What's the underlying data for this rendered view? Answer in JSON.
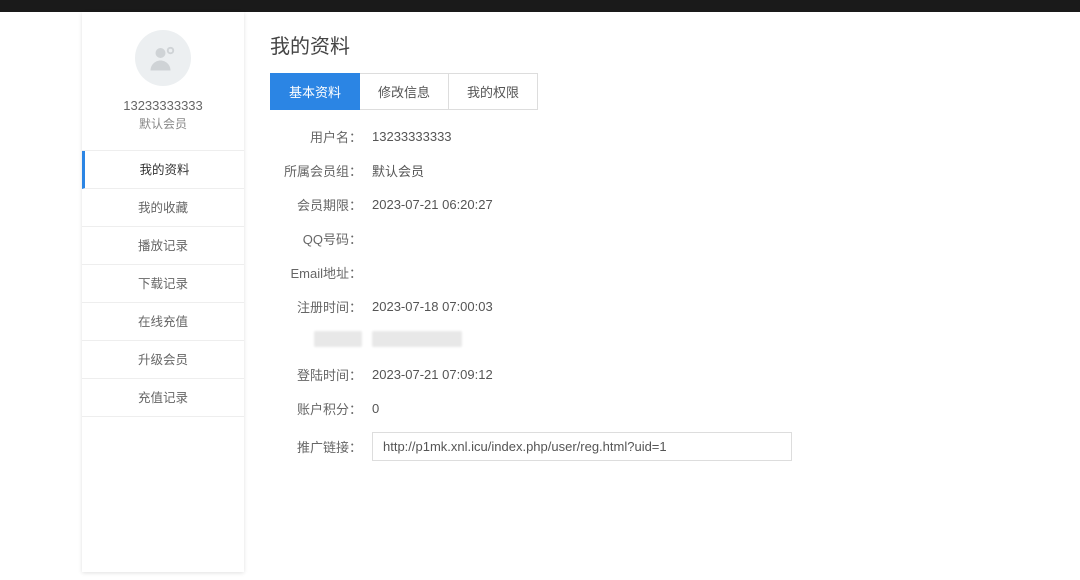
{
  "sidebar": {
    "username": "13233333333",
    "usergroup": "默认会员",
    "nav": [
      {
        "label": "我的资料",
        "active": true
      },
      {
        "label": "我的收藏",
        "active": false
      },
      {
        "label": "播放记录",
        "active": false
      },
      {
        "label": "下载记录",
        "active": false
      },
      {
        "label": "在线充值",
        "active": false
      },
      {
        "label": "升级会员",
        "active": false
      },
      {
        "label": "充值记录",
        "active": false
      }
    ]
  },
  "main": {
    "title": "我的资料",
    "tabs": [
      {
        "label": "基本资料",
        "active": true
      },
      {
        "label": "修改信息",
        "active": false
      },
      {
        "label": "我的权限",
        "active": false
      }
    ],
    "profile": {
      "username_label": "用户名：",
      "username_value": "13233333333",
      "group_label": "所属会员组：",
      "group_value": "默认会员",
      "expire_label": "会员期限：",
      "expire_value": "2023-07-21 06:20:27",
      "qq_label": "QQ号码：",
      "qq_value": "",
      "email_label": "Email地址：",
      "email_value": "",
      "reg_label": "注册时间：",
      "reg_value": "2023-07-18 07:00:03",
      "hidden_label": "",
      "hidden_value": "",
      "login_label": "登陆时间：",
      "login_value": "2023-07-21 07:09:12",
      "points_label": "账户积分：",
      "points_value": "0",
      "promo_label": "推广链接：",
      "promo_value": "http://p1mk.xnl.icu/index.php/user/reg.html?uid=1"
    }
  }
}
